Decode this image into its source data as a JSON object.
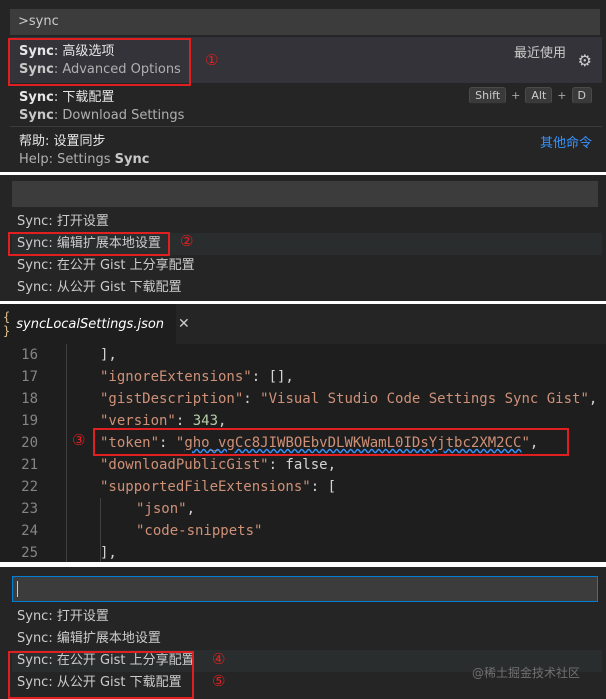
{
  "palette": {
    "input_value": ">sync",
    "items": [
      {
        "prefix": "Sync",
        "label": ": 高级选项",
        "detail_prefix": "Sync",
        "detail": ": Advanced Options",
        "right": "最近使用",
        "icon": "gear-icon"
      },
      {
        "prefix": "Sync",
        "label": ": 下载配置",
        "detail_prefix": "Sync",
        "detail": ": Download Settings",
        "keys": [
          "Shift",
          "Alt",
          "D"
        ],
        "key_sep": "+"
      },
      {
        "label": "帮助: 设置同步",
        "detail": "Help: Settings ",
        "detail_suffix": "Sync",
        "right": "其他命令"
      }
    ]
  },
  "picker1": {
    "items": [
      "Sync: 打开设置",
      "Sync: 编辑扩展本地设置",
      "Sync: 在公开 Gist 上分享配置",
      "Sync: 从公开 Gist 下载配置"
    ]
  },
  "editor": {
    "tab_icon": "{ }",
    "tab_label": "syncLocalSettings.json",
    "tab_close": "✕",
    "lines": [
      {
        "n": "16",
        "text": "],"
      },
      {
        "n": "17",
        "text": "\"ignoreExtensions\": [],"
      },
      {
        "n": "18",
        "text": "\"gistDescription\": \"Visual Studio Code Settings Sync Gist\","
      },
      {
        "n": "19",
        "text": "\"version\": 343,"
      },
      {
        "n": "20",
        "text": "\"token\": \"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\","
      },
      {
        "n": "21",
        "text": "\"downloadPublicGist\": false,"
      },
      {
        "n": "22",
        "text": "\"supportedFileExtensions\": ["
      },
      {
        "n": "23",
        "text": "\"json\","
      },
      {
        "n": "24",
        "text": "\"code-snippets\""
      },
      {
        "n": "25",
        "text": "],"
      }
    ]
  },
  "picker2": {
    "items": [
      "Sync: 打开设置",
      "Sync: 编辑扩展本地设置",
      "Sync: 在公开 Gist 上分享配置",
      "Sync: 从公开 Gist 下载配置"
    ]
  },
  "annotations": [
    "①",
    "②",
    "③",
    "④",
    "⑤"
  ],
  "watermark": "@稀土掘金技术社区",
  "colors": {
    "accent": "#3794ff",
    "annotation": "#e02020",
    "string": "#ce9178",
    "number": "#b5cea8",
    "keyword": "#569cd6"
  }
}
